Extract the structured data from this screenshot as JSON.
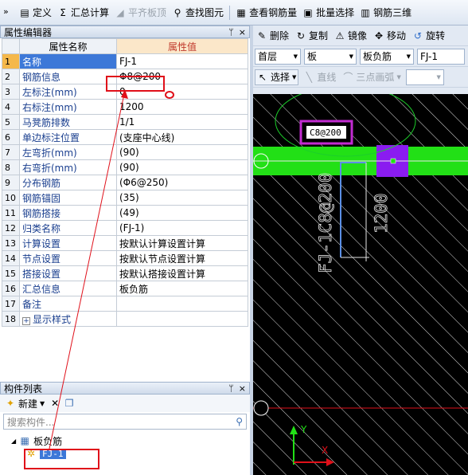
{
  "toolbar": {
    "define": "定义",
    "sum": "汇总计算",
    "flat_top": "平齐板顶",
    "find": "查找图元",
    "view_rebar": "查看钢筋量",
    "batch_select": "批量选择",
    "rebar_3d": "钢筋三维"
  },
  "prop_editor": {
    "title": "属性编辑器",
    "col_name": "属性名称",
    "col_value": "属性值",
    "rows": [
      {
        "idx": "1",
        "name": "名称",
        "value": "FJ-1"
      },
      {
        "idx": "2",
        "name": "钢筋信息",
        "value": "Φ8@200"
      },
      {
        "idx": "3",
        "name": "左标注(mm)",
        "value": "0"
      },
      {
        "idx": "4",
        "name": "右标注(mm)",
        "value": "1200"
      },
      {
        "idx": "5",
        "name": "马凳筋排数",
        "value": "1/1"
      },
      {
        "idx": "6",
        "name": "单边标注位置",
        "value": "(支座中心线)"
      },
      {
        "idx": "7",
        "name": "左弯折(mm)",
        "value": "(90)"
      },
      {
        "idx": "8",
        "name": "右弯折(mm)",
        "value": "(90)"
      },
      {
        "idx": "9",
        "name": "分布钢筋",
        "value": "(Φ6@250)"
      },
      {
        "idx": "10",
        "name": "钢筋锚固",
        "value": "(35)"
      },
      {
        "idx": "11",
        "name": "钢筋搭接",
        "value": "(49)"
      },
      {
        "idx": "12",
        "name": "归类名称",
        "value": "(FJ-1)"
      },
      {
        "idx": "13",
        "name": "计算设置",
        "value": "按默认计算设置计算"
      },
      {
        "idx": "14",
        "name": "节点设置",
        "value": "按默认节点设置计算"
      },
      {
        "idx": "15",
        "name": "搭接设置",
        "value": "按默认搭接设置计算"
      },
      {
        "idx": "16",
        "name": "汇总信息",
        "value": "板负筋"
      },
      {
        "idx": "17",
        "name": "备注",
        "value": ""
      },
      {
        "idx": "18",
        "name": "显示样式",
        "value": ""
      }
    ]
  },
  "component_list": {
    "title": "构件列表",
    "new_label": "新建",
    "search_placeholder": "搜索构件...",
    "tree_root": "板负筋",
    "tree_child": "FJ-1"
  },
  "right_toolbar": {
    "delete": "删除",
    "copy": "复制",
    "mirror": "镜像",
    "move": "移动",
    "rotate": "旋转",
    "floor": "首层",
    "category": "板",
    "type": "板负筋",
    "name": "FJ-1",
    "select": "选择",
    "line": "直线",
    "arc": "三点画弧"
  },
  "canvas": {
    "rebar_label": "C8@200",
    "rebar_text": "FJ-1C8@200",
    "dim_text": "1200",
    "axis_y": "Y",
    "axis_x": "X"
  },
  "colors": {
    "accent": "#e0101a",
    "slab": "#22e016",
    "support": "#8a1cf0",
    "highlight_border": "#c22bd1"
  },
  "icons": [
    "define-icon",
    "sum-icon",
    "find-icon",
    "view-rebar-icon",
    "batch-select-icon",
    "rebar-3d-icon",
    "delete-icon",
    "copy-icon",
    "mirror-icon",
    "move-icon",
    "rotate-icon",
    "select-icon",
    "line-icon",
    "arc-icon",
    "new-icon",
    "delete-x-icon",
    "copy-small-icon",
    "search-icon",
    "pin-icon",
    "close-icon"
  ]
}
